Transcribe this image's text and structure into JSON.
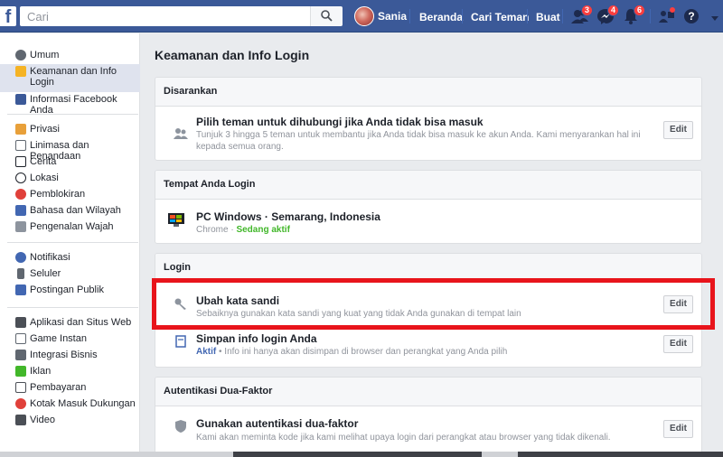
{
  "topbar": {
    "logo": "f",
    "search_placeholder": "Cari",
    "user_name": "Sania",
    "nav_home": "Beranda",
    "nav_find_friends": "Cari Teman",
    "nav_create": "Buat",
    "badges": {
      "friends": "3",
      "messages": "4",
      "notifications": "6"
    },
    "brand_color": "#3b5998"
  },
  "sidebar": {
    "group1": [
      {
        "label": "Umum",
        "icon": "gear-icon"
      },
      {
        "label": "Keamanan dan Info Login",
        "icon": "shield-icon"
      },
      {
        "label": "Informasi Facebook Anda",
        "icon": "facebook-icon"
      }
    ],
    "group2": [
      {
        "label": "Privasi",
        "icon": "lock-icon"
      },
      {
        "label": "Linimasa dan Penandaan",
        "icon": "timeline-icon"
      },
      {
        "label": "Cerita",
        "icon": "book-icon"
      },
      {
        "label": "Lokasi",
        "icon": "location-icon"
      },
      {
        "label": "Pemblokiran",
        "icon": "block-icon"
      },
      {
        "label": "Bahasa dan Wilayah",
        "icon": "language-icon"
      },
      {
        "label": "Pengenalan Wajah",
        "icon": "face-icon"
      }
    ],
    "group3": [
      {
        "label": "Notifikasi",
        "icon": "globe-icon"
      },
      {
        "label": "Seluler",
        "icon": "mobile-icon"
      },
      {
        "label": "Postingan Publik",
        "icon": "rss-icon"
      }
    ],
    "group4": [
      {
        "label": "Aplikasi dan Situs Web",
        "icon": "apps-icon"
      },
      {
        "label": "Game Instan",
        "icon": "gamepad-icon"
      },
      {
        "label": "Integrasi Bisnis",
        "icon": "business-icon"
      },
      {
        "label": "Iklan",
        "icon": "ads-icon"
      },
      {
        "label": "Pembayaran",
        "icon": "card-icon"
      },
      {
        "label": "Kotak Masuk Dukungan",
        "icon": "lifebuoy-icon"
      },
      {
        "label": "Video",
        "icon": "video-icon"
      }
    ]
  },
  "main": {
    "title": "Keamanan dan Info Login",
    "recommended": {
      "header": "Disarankan",
      "title": "Pilih teman untuk dihubungi jika Anda tidak bisa masuk",
      "desc": "Tunjuk 3 hingga 5 teman untuk membantu jika Anda tidak bisa masuk ke akun Anda. Kami menyarankan hal ini kepada semua orang.",
      "edit": "Edit"
    },
    "where_logged": {
      "header": "Tempat Anda Login",
      "device": "PC Windows · Semarang, Indonesia",
      "browser": "Chrome · ",
      "status": "Sedang aktif"
    },
    "login": {
      "header": "Login",
      "change_pw_title": "Ubah kata sandi",
      "change_pw_desc": "Sebaiknya gunakan kata sandi yang kuat yang tidak Anda gunakan di tempat lain",
      "save_login_title": "Simpan info login Anda",
      "save_login_status": "Aktif",
      "save_login_desc": " • Info ini hanya akan disimpan di browser dan perangkat yang Anda pilih",
      "edit": "Edit"
    },
    "two_factor": {
      "header": "Autentikasi Dua-Faktor",
      "title": "Gunakan autentikasi dua-faktor",
      "desc": "Kami akan meminta kode jika kami melihat upaya login dari perangkat atau browser yang tidak dikenali.",
      "edit": "Edit"
    }
  }
}
